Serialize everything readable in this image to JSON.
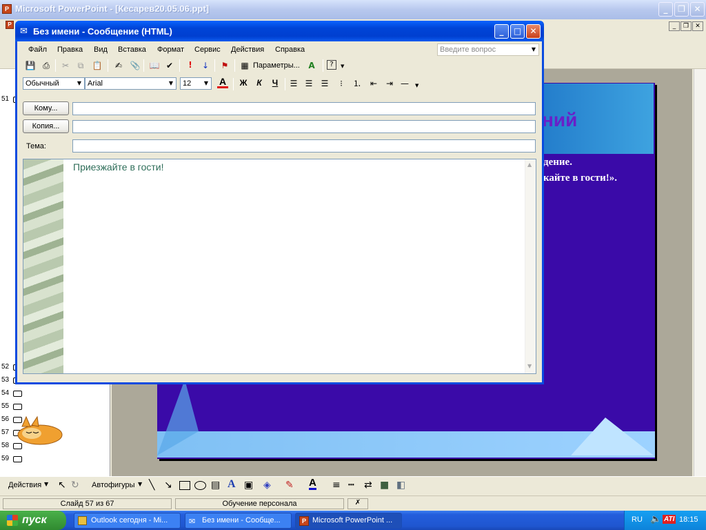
{
  "powerpoint": {
    "title": "Microsoft PowerPoint - [Кесарев20.05.06.ppt]",
    "slide_numbers": [
      "51",
      "52",
      "53",
      "54",
      "55",
      "56",
      "57",
      "58",
      "59"
    ],
    "slide_text": {
      "heading_fragment": "ний",
      "line1": "дение.",
      "line2": "кайте в гости!»."
    }
  },
  "message": {
    "title": "Без имени - Сообщение (HTML)",
    "menu": [
      "Файл",
      "Правка",
      "Вид",
      "Вставка",
      "Формат",
      "Сервис",
      "Действия",
      "Справка"
    ],
    "question_placeholder": "Введите вопрос",
    "params_label": "Параметры...",
    "style": "Обычный",
    "font": "Arial",
    "size": "12",
    "format_buttons": {
      "bold": "Ж",
      "italic": "К",
      "underline": "Ч"
    },
    "to_label": "Кому...",
    "cc_label": "Копия...",
    "subject_label": "Тема:",
    "to_value": "",
    "cc_value": "",
    "subject_value": "",
    "body": "Приезжайте в гости!"
  },
  "drawbar": {
    "actions": "Действия",
    "autoshapes": "Автофигуры"
  },
  "status": {
    "slide": "Слайд 57 из 67",
    "design": "Обучение персонала"
  },
  "taskbar": {
    "start": "пуск",
    "items": [
      "Outlook сегодня - Mi...",
      "Без имени - Сообще...",
      "Microsoft PowerPoint ..."
    ],
    "lang": "RU",
    "clock": "18:15"
  }
}
